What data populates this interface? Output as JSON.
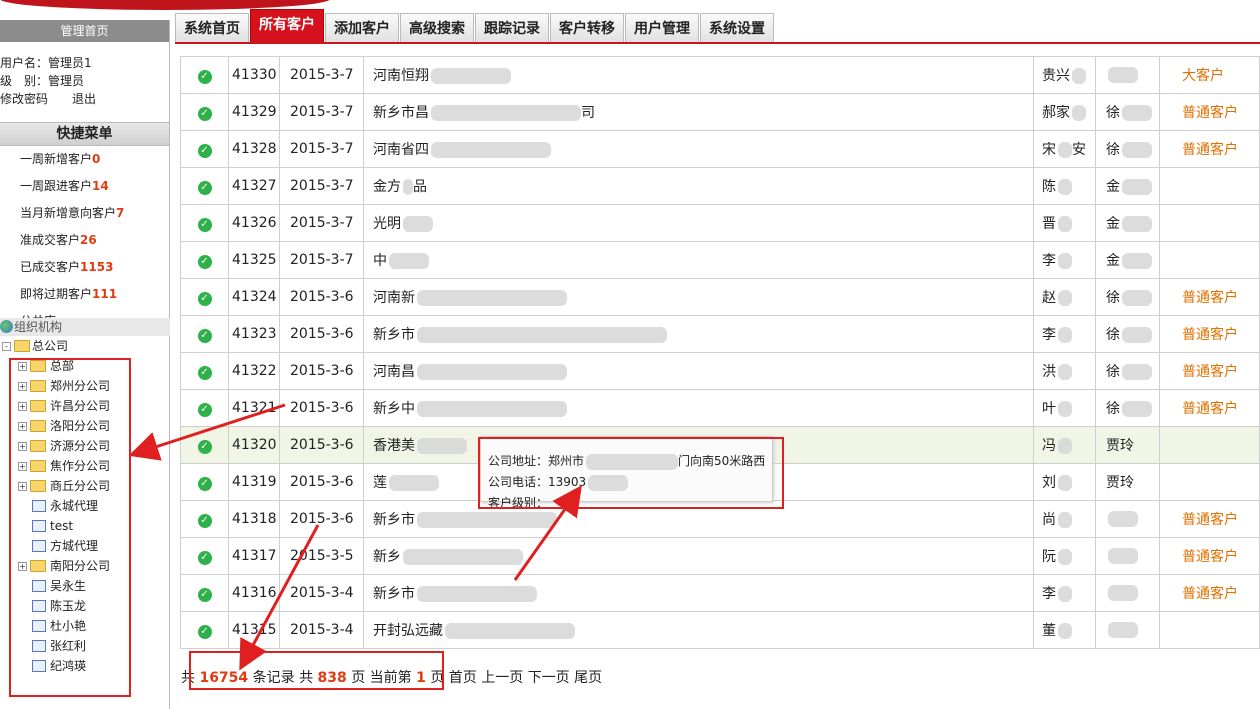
{
  "left": {
    "header": "管理首页",
    "username_label": "用户名：",
    "username": "管理员1",
    "level_label": "级　别：",
    "level": "管理员",
    "change_password": "修改密码",
    "logout": "退出",
    "quick_title": "快捷菜单",
    "quick_items": [
      {
        "label": "一周新增客户",
        "count": "0"
      },
      {
        "label": "一周跟进客户",
        "count": "14"
      },
      {
        "label": "当月新增意向客户",
        "count": "7"
      },
      {
        "label": "准成交客户",
        "count": "26"
      },
      {
        "label": "已成交客户",
        "count": "1153"
      },
      {
        "label": "即将过期客户",
        "count": "111"
      },
      {
        "label": "公共库",
        "count": ""
      }
    ],
    "org_title": "组织机构",
    "tree": [
      {
        "label": "总公司",
        "type": "folder",
        "level": 0
      },
      {
        "label": "总部",
        "type": "folder",
        "level": 1
      },
      {
        "label": "郑州分公司",
        "type": "folder",
        "level": 1
      },
      {
        "label": "许昌分公司",
        "type": "folder",
        "level": 1
      },
      {
        "label": "洛阳分公司",
        "type": "folder",
        "level": 1
      },
      {
        "label": "济源分公司",
        "type": "folder",
        "level": 1
      },
      {
        "label": "焦作分公司",
        "type": "folder",
        "level": 1
      },
      {
        "label": "商丘分公司",
        "type": "folder",
        "level": 1
      },
      {
        "label": "永城代理",
        "type": "doc",
        "level": 1
      },
      {
        "label": "test",
        "type": "doc",
        "level": 1
      },
      {
        "label": "方城代理",
        "type": "doc",
        "level": 1
      },
      {
        "label": "南阳分公司",
        "type": "folder",
        "level": 1
      },
      {
        "label": "吴永生",
        "type": "doc",
        "level": 1
      },
      {
        "label": "陈玉龙",
        "type": "doc",
        "level": 1
      },
      {
        "label": "杜小艳",
        "type": "doc",
        "level": 1
      },
      {
        "label": "张红利",
        "type": "doc",
        "level": 1
      },
      {
        "label": "纪鸿瑛",
        "type": "doc",
        "level": 1
      }
    ]
  },
  "tabs": [
    "系统首页",
    "所有客户",
    "添加客户",
    "高级搜索",
    "跟踪记录",
    "客户转移",
    "用户管理",
    "系统设置"
  ],
  "active_tab": "所有客户",
  "rows": [
    {
      "id": "41330",
      "date": "2015-3-7",
      "company": "河南恒翔",
      "contact": "贵兴",
      "owner": "",
      "level": "大客户"
    },
    {
      "id": "41329",
      "date": "2015-3-7",
      "company": "新乡市昌",
      "company_tail": "司",
      "contact": "郝家",
      "owner": "徐",
      "level": "普通客户"
    },
    {
      "id": "41328",
      "date": "2015-3-7",
      "company": "河南省四",
      "contact": "宋",
      "contact_tail": "安",
      "owner": "徐",
      "level": "普通客户"
    },
    {
      "id": "41327",
      "date": "2015-3-7",
      "company": "金方",
      "company_tail": "品",
      "contact": "陈",
      "owner": "金",
      "level": ""
    },
    {
      "id": "41326",
      "date": "2015-3-7",
      "company": "光明",
      "contact": "晋",
      "owner": "金",
      "level": ""
    },
    {
      "id": "41325",
      "date": "2015-3-7",
      "company": "中",
      "contact": "李",
      "owner": "金",
      "level": ""
    },
    {
      "id": "41324",
      "date": "2015-3-6",
      "company": "河南新",
      "contact": "赵",
      "owner": "徐",
      "level": "普通客户"
    },
    {
      "id": "41323",
      "date": "2015-3-6",
      "company": "新乡市",
      "contact": "李",
      "owner": "徐",
      "level": "普通客户"
    },
    {
      "id": "41322",
      "date": "2015-3-6",
      "company": "河南昌",
      "contact": "洪",
      "owner": "徐",
      "level": "普通客户"
    },
    {
      "id": "41321",
      "date": "2015-3-6",
      "company": "新乡中",
      "contact": "叶",
      "owner": "徐",
      "level": "普通客户"
    },
    {
      "id": "41320",
      "date": "2015-3-6",
      "company": "香港美",
      "contact": "冯",
      "owner": "贾玲",
      "level": ""
    },
    {
      "id": "41319",
      "date": "2015-3-6",
      "company": "莲",
      "contact": "刘",
      "owner": "贾玲",
      "level": ""
    },
    {
      "id": "41318",
      "date": "2015-3-6",
      "company": "新乡市",
      "contact": "尚",
      "owner": "",
      "level": "普通客户"
    },
    {
      "id": "41317",
      "date": "2015-3-5",
      "company": "新乡",
      "contact": "阮",
      "owner": "",
      "level": "普通客户"
    },
    {
      "id": "41316",
      "date": "2015-3-4",
      "company": "新乡市",
      "contact": "李",
      "owner": "",
      "level": "普通客户"
    },
    {
      "id": "41315",
      "date": "2015-3-4",
      "company": "开封弘远藏",
      "contact": "董",
      "owner": "",
      "level": ""
    }
  ],
  "tooltip": {
    "address_label": "公司地址：",
    "address_start": "郑州市",
    "address_end": "门向南50米路西",
    "phone_label": "公司电话：",
    "phone": "13903",
    "level_label": "客户级别："
  },
  "footer": {
    "prefix": "共",
    "total_records": "16754",
    "records_label": "条记录 共",
    "total_pages": "838",
    "pages_label": "页 当前第",
    "current_page": "1",
    "page_label": "页",
    "first": "首页",
    "prev": "上一页",
    "next": "下一页",
    "last": "尾页"
  },
  "colors": {
    "brand": "#c8161d",
    "accent": "#e23b12",
    "annotation": "#e02020",
    "level": "#e07000"
  }
}
